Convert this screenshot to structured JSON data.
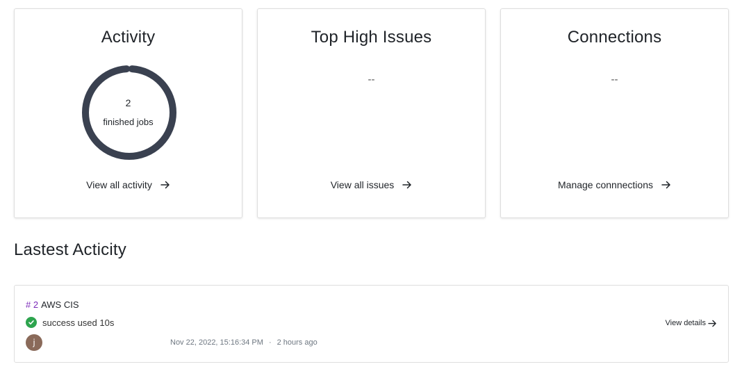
{
  "cards": {
    "activity": {
      "title": "Activity",
      "value": "2",
      "value_label": "finished jobs",
      "progress_fraction": 0.98,
      "link_label": "View all activity"
    },
    "issues": {
      "title": "Top High Issues",
      "empty": "--",
      "link_label": "View all issues"
    },
    "connections": {
      "title": "Connections",
      "empty": "--",
      "link_label": "Manage connnections"
    }
  },
  "latest": {
    "section_title": "Lastest Acticity",
    "items": [
      {
        "number": "# 2",
        "name": "AWS CIS",
        "status_text": "success used 10s",
        "avatar_initial": "j",
        "timestamp": "Nov 22, 2022, 15:16:34 PM",
        "separator": "·",
        "relative_time": "2 hours ago",
        "details_label": "View details"
      }
    ]
  },
  "colors": {
    "donut": "#3a4150",
    "donut_track": "#f0f1f3",
    "success": "#2da44e",
    "job_number": "#7b2ab8"
  },
  "icons": {
    "arrow": "arrow-right-icon",
    "status": "check-circle-icon"
  }
}
